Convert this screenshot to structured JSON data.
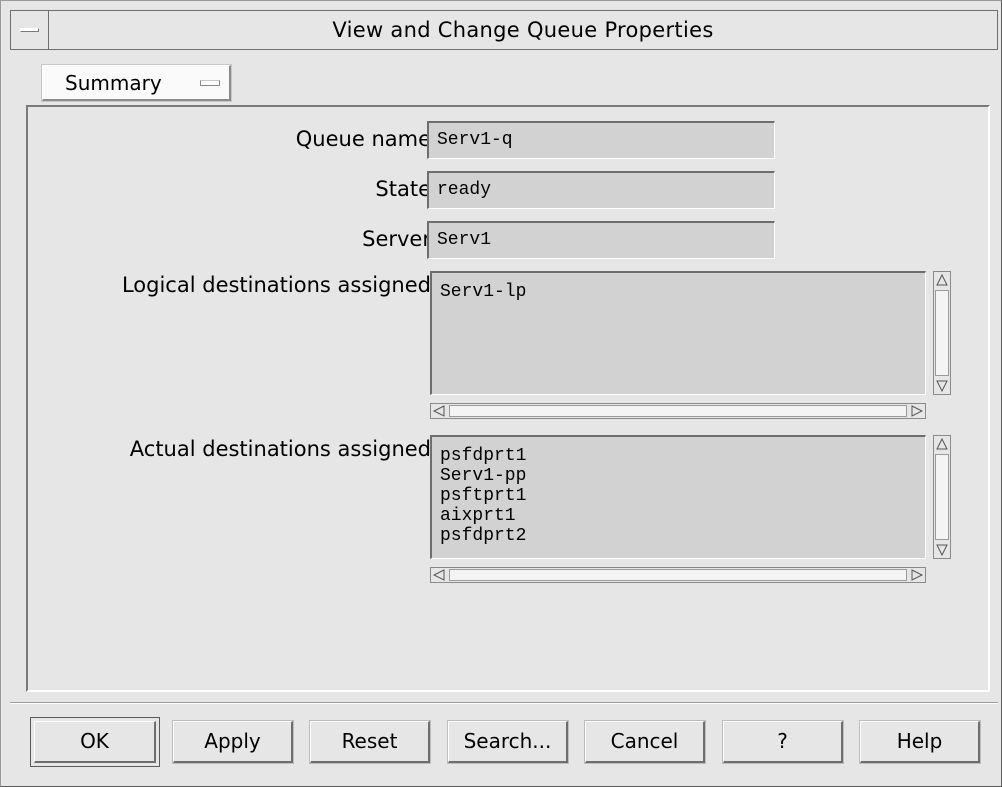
{
  "window": {
    "title": "View and Change Queue Properties"
  },
  "view_selector": {
    "value": "Summary"
  },
  "form": {
    "queue_name_label": "Queue name",
    "queue_name_value": "Serv1-q",
    "state_label": "State",
    "state_value": "ready",
    "server_label": "Server",
    "server_value": "Serv1",
    "logical_label": "Logical destinations assigned",
    "logical_items": [
      "Serv1-lp"
    ],
    "actual_label": "Actual destinations assigned",
    "actual_items": [
      "psfdprt1",
      "Serv1-pp",
      "psftprt1",
      "aixprt1",
      "psfdprt2"
    ]
  },
  "buttons": {
    "ok": "OK",
    "apply": "Apply",
    "reset": "Reset",
    "search": "Search...",
    "cancel": "Cancel",
    "question": "?",
    "help": "Help"
  },
  "icons": {
    "system_menu": "system-menu-icon",
    "dropdown": "dropdown-indicator-icon",
    "scroll_up": "triangle-up-icon",
    "scroll_down": "triangle-down-icon",
    "scroll_left": "triangle-left-icon",
    "scroll_right": "triangle-right-icon"
  },
  "colors": {
    "window_bg": "#e6e6e6",
    "field_bg": "#d2d2d2"
  }
}
